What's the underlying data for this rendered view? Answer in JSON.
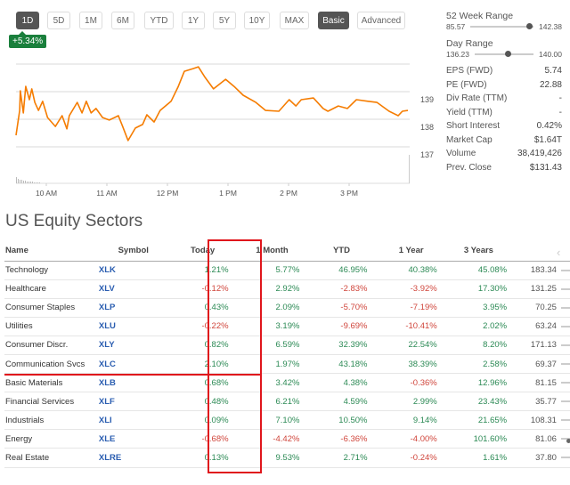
{
  "range_buttons": [
    {
      "label": "1D",
      "active": true
    },
    {
      "label": "5D",
      "active": false
    },
    {
      "label": "1M",
      "active": false
    },
    {
      "label": "6M",
      "active": false
    },
    {
      "label": "YTD",
      "active": false
    },
    {
      "label": "1Y",
      "active": false
    },
    {
      "label": "5Y",
      "active": false
    },
    {
      "label": "10Y",
      "active": false
    },
    {
      "label": "MAX",
      "active": false
    }
  ],
  "view_buttons": [
    {
      "label": "Basic",
      "active": true
    },
    {
      "label": "Advanced",
      "active": false
    }
  ],
  "change_badge": "+5.34%",
  "chart_data": {
    "type": "line",
    "title": "",
    "xlabel": "",
    "ylabel": "",
    "x_ticks": [
      "10 AM",
      "11 AM",
      "12 PM",
      "1 PM",
      "2 PM",
      "3 PM"
    ],
    "y_ticks": [
      139,
      138,
      137
    ],
    "ylim": [
      136.6,
      140.0
    ],
    "x_range_hours": [
      9.5,
      15.97
    ],
    "line_color": "#f57c00",
    "grid": true,
    "series": [
      {
        "name": "Price",
        "points": [
          [
            9.5,
            137.42
          ],
          [
            9.56,
            138.32
          ],
          [
            9.57,
            139.03
          ],
          [
            9.62,
            138.23
          ],
          [
            9.66,
            139.19
          ],
          [
            9.72,
            138.71
          ],
          [
            9.76,
            139.1
          ],
          [
            9.81,
            138.61
          ],
          [
            9.87,
            138.32
          ],
          [
            9.94,
            138.65
          ],
          [
            10.02,
            138.06
          ],
          [
            10.15,
            137.74
          ],
          [
            10.26,
            138.13
          ],
          [
            10.34,
            137.65
          ],
          [
            10.38,
            138.13
          ],
          [
            10.51,
            138.61
          ],
          [
            10.59,
            138.23
          ],
          [
            10.66,
            138.65
          ],
          [
            10.74,
            138.23
          ],
          [
            10.82,
            138.39
          ],
          [
            10.93,
            138.06
          ],
          [
            11.04,
            137.97
          ],
          [
            11.19,
            138.13
          ],
          [
            11.26,
            137.74
          ],
          [
            11.35,
            137.23
          ],
          [
            11.47,
            137.68
          ],
          [
            11.59,
            137.81
          ],
          [
            11.66,
            138.16
          ],
          [
            11.78,
            137.9
          ],
          [
            11.88,
            138.32
          ],
          [
            12.06,
            138.65
          ],
          [
            12.18,
            139.19
          ],
          [
            12.28,
            139.74
          ],
          [
            12.43,
            139.84
          ],
          [
            12.51,
            139.9
          ],
          [
            12.62,
            139.52
          ],
          [
            12.76,
            139.1
          ],
          [
            12.96,
            139.45
          ],
          [
            13.1,
            139.19
          ],
          [
            13.25,
            138.87
          ],
          [
            13.46,
            138.61
          ],
          [
            13.62,
            138.32
          ],
          [
            13.84,
            138.29
          ],
          [
            14.01,
            138.71
          ],
          [
            14.12,
            138.48
          ],
          [
            14.21,
            138.71
          ],
          [
            14.41,
            138.77
          ],
          [
            14.57,
            138.39
          ],
          [
            14.65,
            138.29
          ],
          [
            14.82,
            138.48
          ],
          [
            14.97,
            138.39
          ],
          [
            15.12,
            138.71
          ],
          [
            15.31,
            138.65
          ],
          [
            15.46,
            138.61
          ],
          [
            15.66,
            138.29
          ],
          [
            15.81,
            138.13
          ],
          [
            15.88,
            138.29
          ],
          [
            15.97,
            138.32
          ]
        ]
      }
    ],
    "volume_note": "volume bars shown faintly along the bottom"
  },
  "stats": {
    "week52": {
      "label": "52 Week Range",
      "low": "85.57",
      "high": "142.38",
      "position": 0.93
    },
    "day": {
      "label": "Day Range",
      "low": "136.23",
      "high": "140.00",
      "position": 0.56
    },
    "rows": [
      {
        "label": "EPS (FWD)",
        "value": "5.74"
      },
      {
        "label": "PE (FWD)",
        "value": "22.88"
      },
      {
        "label": "Div Rate (TTM)",
        "value": "-"
      },
      {
        "label": "Yield (TTM)",
        "value": "-"
      },
      {
        "label": "Short Interest",
        "value": "0.42%"
      },
      {
        "label": "Market Cap",
        "value": "$1.64T"
      },
      {
        "label": "Volume",
        "value": "38,419,426"
      },
      {
        "label": "Prev. Close",
        "value": "$131.43"
      }
    ]
  },
  "sectors": {
    "title": "US Equity Sectors",
    "columns": [
      "Name",
      "Symbol",
      "Today",
      "1 Month",
      "YTD",
      "1 Year",
      "3 Years"
    ],
    "rows": [
      {
        "name": "Technology",
        "symbol": "XLK",
        "today": "1.21%",
        "m1": "5.77%",
        "ytd": "46.95%",
        "y1": "40.38%",
        "y3": "45.08%",
        "price": "183.34"
      },
      {
        "name": "Healthcare",
        "symbol": "XLV",
        "today": "-0.12%",
        "m1": "2.92%",
        "ytd": "-2.83%",
        "y1": "-3.92%",
        "y3": "17.30%",
        "price": "131.25"
      },
      {
        "name": "Consumer Staples",
        "symbol": "XLP",
        "today": "0.43%",
        "m1": "2.09%",
        "ytd": "-5.70%",
        "y1": "-7.19%",
        "y3": "3.95%",
        "price": "70.25"
      },
      {
        "name": "Utilities",
        "symbol": "XLU",
        "today": "-0.22%",
        "m1": "3.19%",
        "ytd": "-9.69%",
        "y1": "-10.41%",
        "y3": "2.02%",
        "price": "63.24"
      },
      {
        "name": "Consumer Discr.",
        "symbol": "XLY",
        "today": "0.82%",
        "m1": "6.59%",
        "ytd": "32.39%",
        "y1": "22.54%",
        "y3": "8.20%",
        "price": "171.13"
      },
      {
        "name": "Communication Svcs",
        "symbol": "XLC",
        "today": "2.10%",
        "m1": "1.97%",
        "ytd": "43.18%",
        "y1": "38.39%",
        "y3": "2.58%",
        "price": "69.37"
      },
      {
        "name": "Basic Materials",
        "symbol": "XLB",
        "today": "0.68%",
        "m1": "3.42%",
        "ytd": "4.38%",
        "y1": "-0.36%",
        "y3": "12.96%",
        "price": "81.15"
      },
      {
        "name": "Financial Services",
        "symbol": "XLF",
        "today": "0.48%",
        "m1": "6.21%",
        "ytd": "4.59%",
        "y1": "2.99%",
        "y3": "23.43%",
        "price": "35.77"
      },
      {
        "name": "Industrials",
        "symbol": "XLI",
        "today": "0.09%",
        "m1": "7.10%",
        "ytd": "10.50%",
        "y1": "9.14%",
        "y3": "21.65%",
        "price": "108.31"
      },
      {
        "name": "Energy",
        "symbol": "XLE",
        "today": "-0.68%",
        "m1": "-4.42%",
        "ytd": "-6.36%",
        "y1": "-4.00%",
        "y3": "101.60%",
        "price": "81.06"
      },
      {
        "name": "Real Estate",
        "symbol": "XLRE",
        "today": "0.13%",
        "m1": "9.53%",
        "ytd": "2.71%",
        "y1": "-0.24%",
        "y3": "1.61%",
        "price": "37.80"
      }
    ],
    "scroll_icon": "chevron-left-icon",
    "scroll_glyph": "‹"
  },
  "colors": {
    "positive": "#2c8a55",
    "negative": "#d0463c",
    "highlight": "#e0161c",
    "badge": "#1a7f3c"
  }
}
